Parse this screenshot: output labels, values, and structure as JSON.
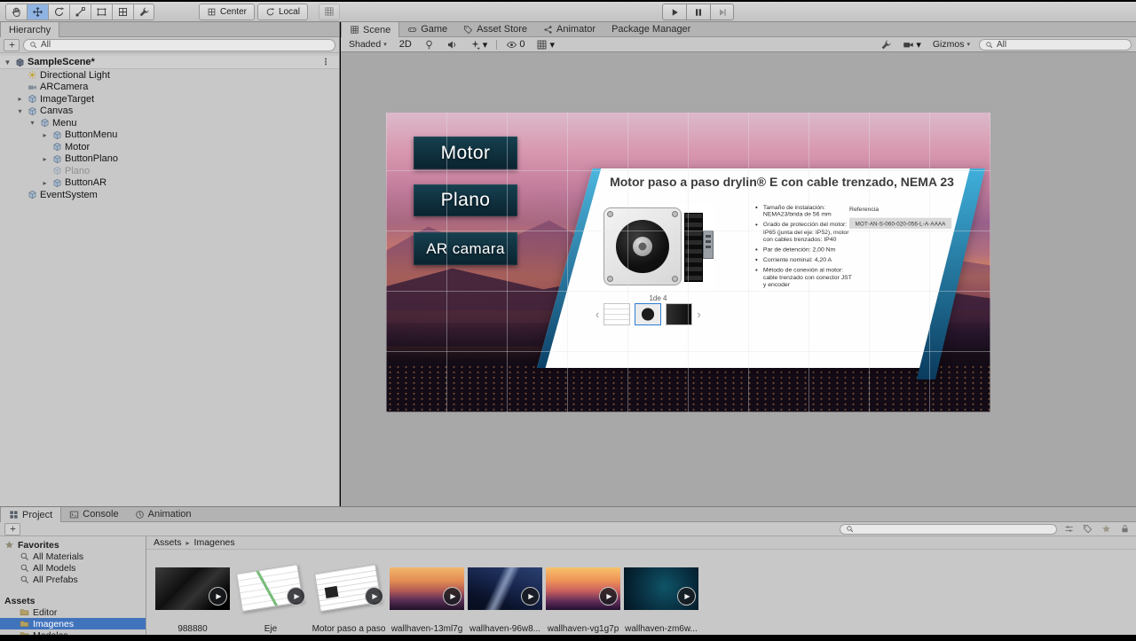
{
  "ui": {
    "caret": "▾",
    "kebab": "⋮"
  },
  "window": {
    "toolbar": {
      "pivot": "Center",
      "space": "Local"
    }
  },
  "hierarchy": {
    "tab": "Hierarchy",
    "search": "All",
    "items": [
      {
        "label": "SampleScene*",
        "arrow": "▼",
        "menu": "⋮"
      },
      {
        "label": "Directional Light",
        "arrow": ""
      },
      {
        "label": "ARCamera",
        "arrow": ""
      },
      {
        "label": "ImageTarget",
        "arrow": "▸"
      },
      {
        "label": "Canvas",
        "arrow": "▾"
      },
      {
        "label": "Menu",
        "arrow": "▾"
      },
      {
        "label": "ButtonMenu",
        "arrow": "▸"
      },
      {
        "label": "Motor",
        "arrow": ""
      },
      {
        "label": "ButtonPlano",
        "arrow": "▸"
      },
      {
        "label": "Plano",
        "arrow": ""
      },
      {
        "label": "ButtonAR",
        "arrow": "▸"
      },
      {
        "label": "EventSystem",
        "arrow": ""
      }
    ]
  },
  "scene": {
    "tabs": [
      "Scene",
      "Game",
      "Asset Store",
      "Animator",
      "Package Manager"
    ],
    "shading_mode": "Shaded",
    "mode_2d": "2D",
    "hidden_count": "0",
    "gizmos_label": "Gizmos",
    "search": "All"
  },
  "game": {
    "menu_buttons": [
      "Motor",
      "Plano",
      "AR camara"
    ],
    "slide": {
      "title": "Motor paso a paso drylin® E con cable trenzado, NEMA 23",
      "bullets": [
        "Tamaño de instalación: NEMA23/brida de 56 mm",
        "Grado de protección del motor: IP65 (junta del eje: IP52), motor con cables trenzados: IP40",
        "Par de detención: 2,00 Nm",
        "Corriente nominal: 4,20 A",
        "Método de conexión al motor: cable trenzado con conector  JST y encoder"
      ],
      "pager": "1de 4",
      "prev": "‹",
      "next": "›",
      "referencia_label": "Referencia",
      "referencia_value": "MOT-AN-S-060-020-056-L-A-AAAA"
    }
  },
  "project": {
    "tabs": [
      "Project",
      "Console",
      "Animation"
    ],
    "favorites_label": "Favorites",
    "favorites": [
      "All Materials",
      "All Models",
      "All Prefabs"
    ],
    "assets_label": "Assets",
    "folders": [
      "Editor",
      "Imagenes",
      "Modelos"
    ],
    "breadcrumb": {
      "root": "Assets",
      "sep": "▸",
      "current": "Imagenes"
    },
    "play_glyph": "▶",
    "items": [
      {
        "label": "988880"
      },
      {
        "label": "Eje"
      },
      {
        "label": "Motor paso a paso"
      },
      {
        "label": "wallhaven-13ml7g"
      },
      {
        "label": "wallhaven-96w8..."
      },
      {
        "label": "wallhaven-vg1g7p"
      },
      {
        "label": "wallhaven-zm6w..."
      }
    ]
  }
}
